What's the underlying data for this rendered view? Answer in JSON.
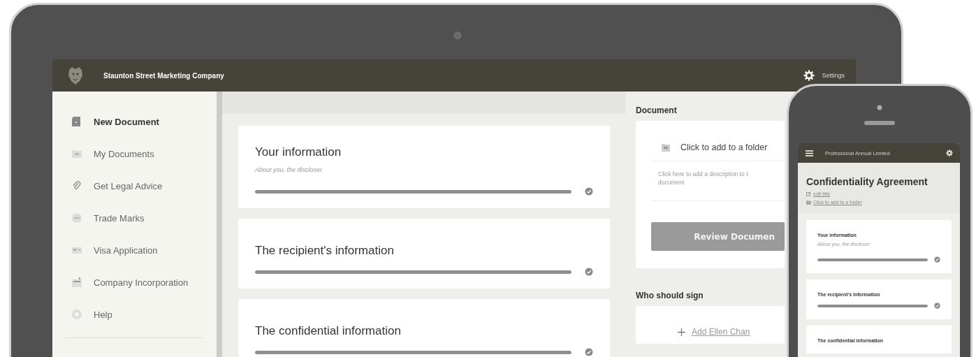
{
  "laptop": {
    "header": {
      "company": "Staunton Street Marketing Company",
      "settings": "Settings"
    },
    "sidebar": {
      "items": [
        {
          "label": "New Document",
          "selected": true
        },
        {
          "label": "My Documents",
          "selected": false
        },
        {
          "label": "Get Legal Advice",
          "selected": false
        },
        {
          "label": "Trade Marks",
          "selected": false
        },
        {
          "label": "Visa Application",
          "selected": false
        },
        {
          "label": "Company Incorporation",
          "selected": false
        },
        {
          "label": "Help",
          "selected": false
        }
      ]
    },
    "sections": [
      {
        "title": "Your information",
        "subtitle": "About you, the discloser",
        "level": 1,
        "complete": true
      },
      {
        "title": "The recipient's information",
        "level": 1,
        "complete": true
      },
      {
        "title": "The confidential information",
        "level": 1,
        "complete": true
      }
    ],
    "document": {
      "heading": "Document",
      "folder_link": "Click to add to a folder",
      "description": [
        "Click here to add a description to t",
        "document"
      ],
      "review_button": "Review Documen"
    },
    "signers": {
      "heading": "Who should sign",
      "add_link": "Add Ellen Chan"
    }
  },
  "phone": {
    "header": {
      "company": "Professional Annual Limited"
    },
    "title": "Confidentiality Agreement",
    "edit_link": "edit title",
    "folder_link": "Click to add to a folder",
    "sections": [
      {
        "title": "Your information",
        "subtitle": "About you, the discloser",
        "level": 1,
        "complete": true
      },
      {
        "title": "The recipient's information",
        "level": 1,
        "complete": true
      },
      {
        "title": "The confidential information"
      }
    ]
  }
}
